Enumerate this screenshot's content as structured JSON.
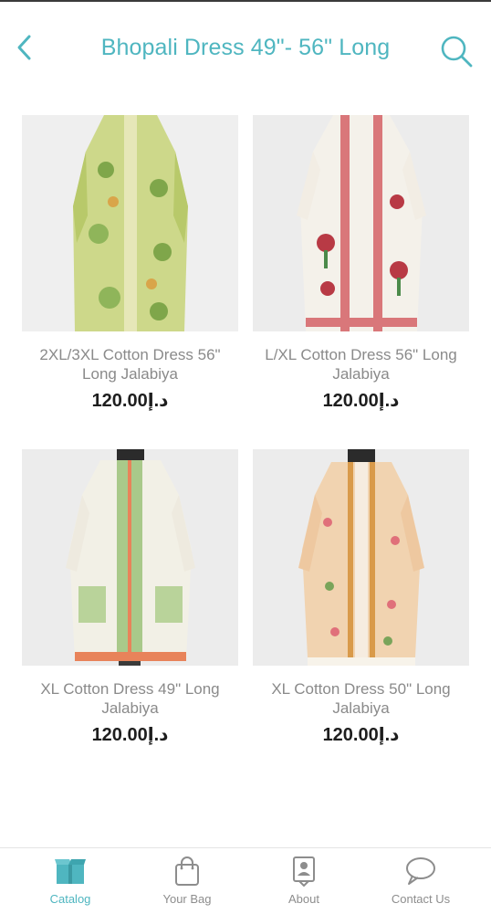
{
  "header": {
    "title": "Bhopali Dress 49\"- 56\" Long"
  },
  "colors": {
    "accent": "#4fb6c0",
    "muted": "#8d8d8d",
    "price": "#1e1e1e"
  },
  "products": [
    {
      "name": "2XL/3XL Cotton Dress 56\" Long Jalabiya",
      "price": "120.00د.إ",
      "image_icon": "green-paisley-dress-photo"
    },
    {
      "name": "L/XL Cotton Dress 56\" Long Jalabiya",
      "price": "120.00د.إ",
      "image_icon": "white-red-floral-dress-photo"
    },
    {
      "name": "XL Cotton Dress 49\" Long Jalabiya",
      "price": "120.00د.إ",
      "image_icon": "white-green-print-dress-photo"
    },
    {
      "name": "XL Cotton Dress 50\" Long Jalabiya",
      "price": "120.00د.إ",
      "image_icon": "peach-floral-dress-photo"
    }
  ],
  "tabs": [
    {
      "label": "Catalog",
      "icon": "catalog-box-icon",
      "active": true
    },
    {
      "label": "Your Bag",
      "icon": "shopping-bag-icon",
      "active": false
    },
    {
      "label": "About",
      "icon": "contact-card-icon",
      "active": false
    },
    {
      "label": "Contact Us",
      "icon": "chat-bubble-icon",
      "active": false
    }
  ]
}
